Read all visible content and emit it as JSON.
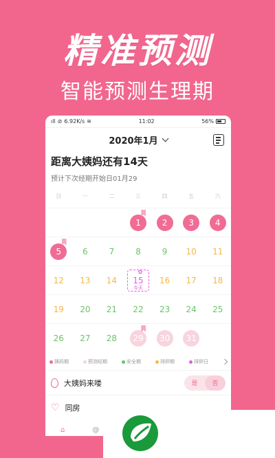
{
  "headline": "精准预测",
  "subline": "智能预测生理期",
  "status": {
    "signal": "ıll",
    "speed": "6.92K/s",
    "time": "11:02",
    "battery": "56%"
  },
  "header": {
    "month": "2020年1月"
  },
  "info": {
    "title": "距离大姨妈还有14天",
    "subtitle": "预计下次经期开始日01月29"
  },
  "weekdays": [
    "日",
    "一",
    "二",
    "三",
    "四",
    "五",
    "六"
  ],
  "calendar": {
    "rows": [
      [
        {
          "d": "",
          "t": "empty"
        },
        {
          "d": "",
          "t": "empty"
        },
        {
          "d": "",
          "t": "empty"
        },
        {
          "d": "1",
          "t": "period",
          "flag": true
        },
        {
          "d": "2",
          "t": "period"
        },
        {
          "d": "3",
          "t": "period"
        },
        {
          "d": "4",
          "t": "period"
        }
      ],
      [
        {
          "d": "5",
          "t": "period",
          "flag": true
        },
        {
          "d": "6",
          "t": "safe"
        },
        {
          "d": "7",
          "t": "safe"
        },
        {
          "d": "8",
          "t": "safe"
        },
        {
          "d": "9",
          "t": "safe"
        },
        {
          "d": "10",
          "t": "ovu"
        },
        {
          "d": "11",
          "t": "ovu"
        }
      ],
      [
        {
          "d": "12",
          "t": "ovu"
        },
        {
          "d": "13",
          "t": "ovu"
        },
        {
          "d": "14",
          "t": "ovu"
        },
        {
          "d": "15",
          "t": "ovuday",
          "today": true
        },
        {
          "d": "16",
          "t": "ovu"
        },
        {
          "d": "17",
          "t": "ovu"
        },
        {
          "d": "18",
          "t": "ovu"
        }
      ],
      [
        {
          "d": "19",
          "t": "ovu"
        },
        {
          "d": "20",
          "t": "safe"
        },
        {
          "d": "21",
          "t": "safe"
        },
        {
          "d": "22",
          "t": "safe"
        },
        {
          "d": "23",
          "t": "safe"
        },
        {
          "d": "24",
          "t": "safe"
        },
        {
          "d": "25",
          "t": "safe"
        }
      ],
      [
        {
          "d": "26",
          "t": "safe"
        },
        {
          "d": "27",
          "t": "safe"
        },
        {
          "d": "28",
          "t": "safe"
        },
        {
          "d": "29",
          "t": "predict",
          "flag": true
        },
        {
          "d": "30",
          "t": "predict"
        },
        {
          "d": "31",
          "t": "predict"
        },
        {
          "d": "",
          "t": "empty"
        }
      ]
    ],
    "today_label": "今天"
  },
  "legend": [
    {
      "label": "姨妈期",
      "color": "#f06c94"
    },
    {
      "label": "预测经期",
      "color": "#f8d4de"
    },
    {
      "label": "安全期",
      "color": "#6ac36a"
    },
    {
      "label": "排卵期",
      "color": "#f5b844"
    },
    {
      "label": "排卵日",
      "color": "#e95ae0"
    }
  ],
  "actions": {
    "period": {
      "label": "大姨妈来喽",
      "yes": "是",
      "no": "否"
    },
    "intimacy": {
      "label": "同房"
    }
  },
  "colors": {
    "background": "#f2668e",
    "accent": "#f06c94"
  }
}
